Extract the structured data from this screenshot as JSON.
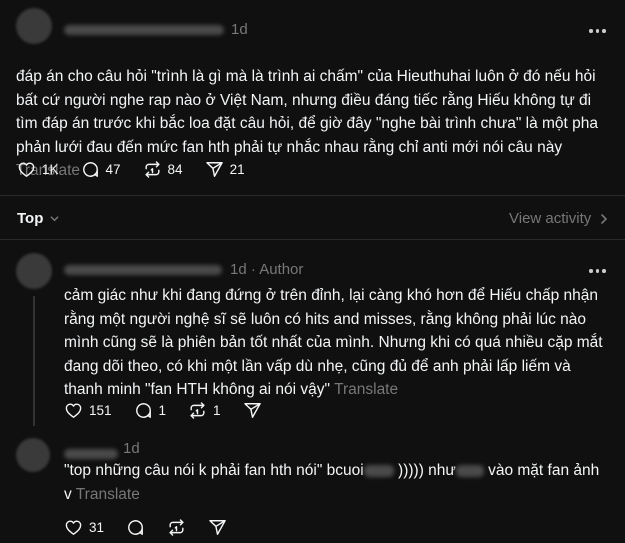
{
  "post": {
    "time": "1d",
    "text": "đáp án cho câu hỏi \"trình là gì mà là trình ai chấm\" của Hieuthuhai luôn ở đó nếu hỏi bất cứ người nghe rap nào ở Việt Nam, nhưng điều đáng tiếc rằng Hiếu không tự đi tìm đáp án trước khi bắc loa đặt câu hỏi, để giờ đây \"nghe bài trình chưa\" là một pha phản lưới đau đến mức fan hth phải tự nhắc nhau rằng chỉ anti mới nói câu này",
    "translate": "Translate",
    "likes": "1K",
    "replies": "47",
    "reposts": "84",
    "shares": "21"
  },
  "sort": {
    "label": "Top",
    "view_activity": "View activity"
  },
  "reply1": {
    "time": "1d",
    "author_badge": "Author",
    "text": "cảm giác như khi đang đứng ở trên đỉnh, lại càng khó hơn để Hiếu chấp nhận rằng một người nghệ sĩ sẽ luôn có hits and misses, rằng không phải lúc nào mình cũng sẽ là phiên bản tốt nhất của mình. Nhưng khi có quá nhiều cặp mắt đang dõi theo, có khi một lần vấp dù nhẹ, cũng đủ để anh phải lấp liếm và thanh minh \"fan HTH không ai nói vậy\"",
    "translate": "Translate",
    "likes": "151",
    "replies": "1",
    "reposts": "1"
  },
  "reply2": {
    "time": "1d",
    "text_part1": "\"top những câu nói k phải fan hth nói\" bcuoi",
    "text_part2": "))))) như",
    "text_part3": "vào mặt fan ảnh",
    "text_line2": "v",
    "translate": "Translate",
    "likes": "31"
  },
  "icons": {
    "heart": "heart-icon",
    "comment": "comment-icon",
    "repost": "repost-icon",
    "share": "share-icon",
    "more": "more-icon",
    "chevron": "chevron-icon"
  }
}
